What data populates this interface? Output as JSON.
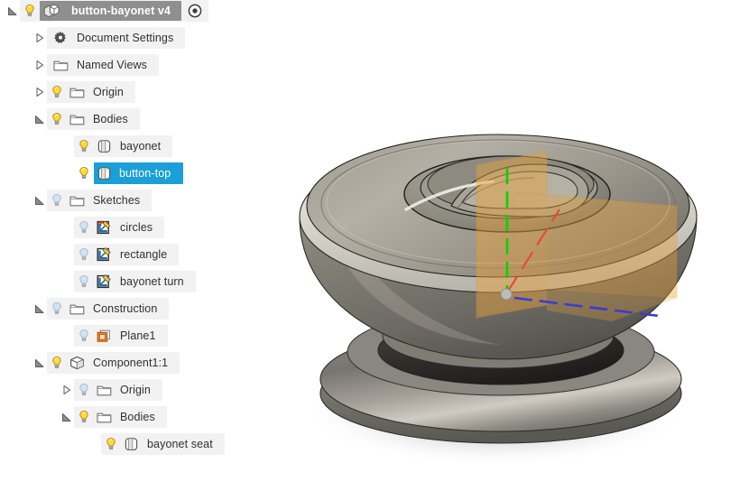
{
  "window": {
    "title": "button-bayonet v4"
  },
  "browser": {
    "root": {
      "label": "button-bayonet v4",
      "icon": "document-icon",
      "state_icon": "radio-target-icon",
      "expanded": true,
      "bulb": "on"
    },
    "nodes": [
      {
        "id": "document-settings",
        "label": "Document Settings",
        "icon": "gear-icon",
        "indent": 1,
        "arrow": "collapsed",
        "bulb": "none"
      },
      {
        "id": "named-views",
        "label": "Named Views",
        "icon": "folder-icon",
        "indent": 1,
        "arrow": "collapsed",
        "bulb": "none"
      },
      {
        "id": "origin",
        "label": "Origin",
        "icon": "folder-icon",
        "indent": 1,
        "arrow": "collapsed",
        "bulb": "on"
      },
      {
        "id": "bodies",
        "label": "Bodies",
        "icon": "folder-icon",
        "indent": 1,
        "arrow": "expanded",
        "bulb": "on"
      },
      {
        "id": "bayonet",
        "label": "bayonet",
        "icon": "body-icon",
        "indent": 2,
        "arrow": "none",
        "bulb": "on"
      },
      {
        "id": "button-top",
        "label": "button-top",
        "icon": "body-icon",
        "indent": 2,
        "arrow": "none",
        "bulb": "on",
        "selected": true
      },
      {
        "id": "sketches",
        "label": "Sketches",
        "icon": "folder-icon",
        "indent": 1,
        "arrow": "expanded",
        "bulb": "off"
      },
      {
        "id": "circles",
        "label": "circles",
        "icon": "sketch-pinned-icon",
        "indent": 2,
        "arrow": "none",
        "bulb": "off"
      },
      {
        "id": "rectangle",
        "label": "rectangle",
        "icon": "sketch-icon",
        "indent": 2,
        "arrow": "none",
        "bulb": "off"
      },
      {
        "id": "bayonet-turn",
        "label": "bayonet turn",
        "icon": "sketch-icon",
        "indent": 2,
        "arrow": "none",
        "bulb": "off"
      },
      {
        "id": "construction",
        "label": "Construction",
        "icon": "folder-icon",
        "indent": 1,
        "arrow": "expanded",
        "bulb": "off"
      },
      {
        "id": "plane1",
        "label": "Plane1",
        "icon": "plane-icon",
        "indent": 2,
        "arrow": "none",
        "bulb": "off"
      },
      {
        "id": "component1",
        "label": "Component1:1",
        "icon": "component-icon",
        "indent": 1,
        "arrow": "expanded",
        "bulb": "on"
      },
      {
        "id": "component1-origin",
        "label": "Origin",
        "icon": "folder-icon",
        "indent": 2,
        "arrow": "collapsed",
        "bulb": "off"
      },
      {
        "id": "component1-bodies",
        "label": "Bodies",
        "icon": "folder-icon",
        "indent": 2,
        "arrow": "expanded",
        "bulb": "on"
      },
      {
        "id": "bayonet-seat",
        "label": "bayonet seat",
        "icon": "body-icon",
        "indent": 3,
        "arrow": "none",
        "bulb": "on"
      }
    ]
  },
  "viewport": {
    "name": "3d-canvas",
    "background": "#ffffff",
    "model_colors": {
      "body_light": "#b3afa4",
      "body_mid": "#8b887d",
      "body_dark": "#585650",
      "highlight": "#efeee9",
      "shadow": "#e2e2e2"
    },
    "construction_plane_color": "#e8a33d",
    "axes": {
      "z_axis_color": "#00d400",
      "x_axis_color": "#e8483c",
      "y_axis_color": "#3b3bd4",
      "origin_point_color": "#b8b8b8"
    }
  },
  "colors": {
    "selection_blue": "#1a9fd9",
    "row_background": "#f2f2f2",
    "root_chip": "#8f8f8f",
    "bulb_on": "#ffd83b",
    "bulb_off": "#c6d9ef",
    "text": "#303030"
  }
}
